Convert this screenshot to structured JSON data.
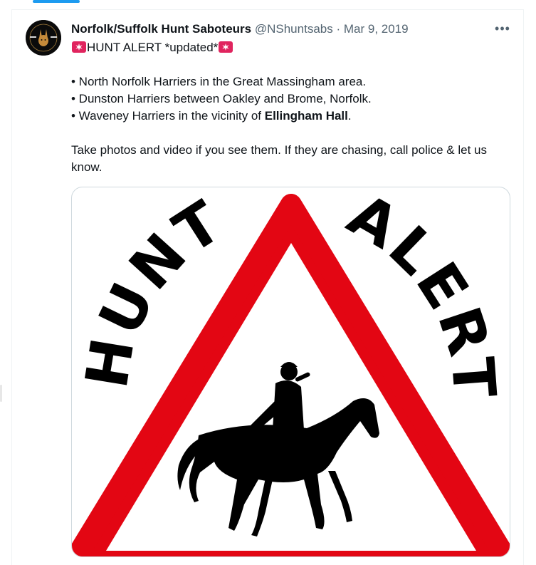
{
  "tweet": {
    "author_name": "Norfolk/Suffolk Hunt Saboteurs",
    "handle": "@NShuntsabs",
    "separator": "·",
    "date": "Mar 9, 2019",
    "more_icon": "more-horizontal-icon",
    "avatar_icon": "hare-logo-icon",
    "alert_title": "HUNT ALERT *updated*",
    "alert_icon": "police-siren-icon",
    "bullets": [
      {
        "text": "• North Norfolk Harriers in the Great Massingham area."
      },
      {
        "text": "• Dunston Harriers between Oakley and Brome, Norfolk."
      },
      {
        "prefix": "• Waveney Harriers in the vicinity of ",
        "bold": "Ellingham Hall",
        "suffix": "."
      }
    ],
    "note": "Take photos and video if you see them. If they are chasing, call police & let us know."
  },
  "media": {
    "image": "hunt-alert-warning-sign",
    "sign_words": [
      "HUNT",
      "ALERT"
    ],
    "sign_icon": "horse-and-rider-icon"
  },
  "colors": {
    "accent": "#1d9bf0",
    "sign_red": "#e30613",
    "siren_red": "#e0245e",
    "text": "#0f1419",
    "muted": "#536471"
  }
}
